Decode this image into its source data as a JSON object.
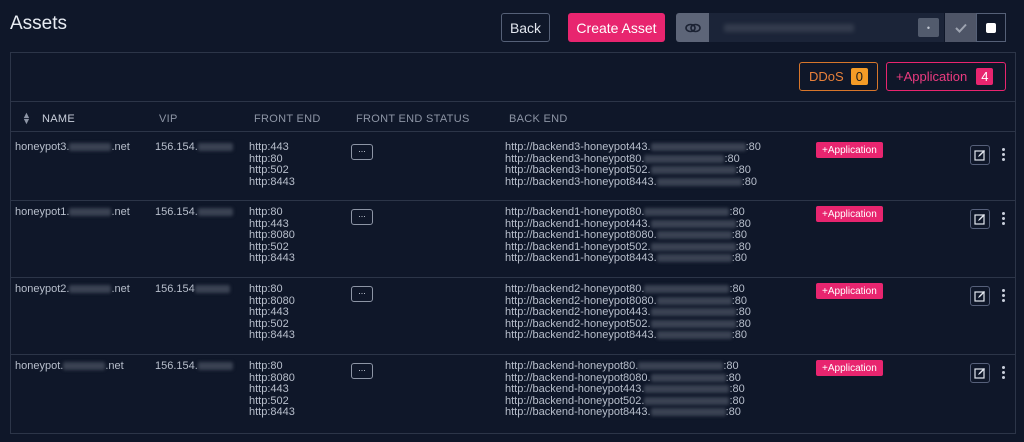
{
  "header": {
    "title": "Assets",
    "back_label": "Back",
    "create_label": "Create Asset",
    "dot_label": "•"
  },
  "badges": {
    "ddos": {
      "label": "DDoS",
      "count": "0"
    },
    "application": {
      "label": "+Application",
      "count": "4"
    }
  },
  "columns": [
    "NAME",
    "VIP",
    "FRONT END",
    "FRONT END STATUS",
    "BACK END"
  ],
  "rows": [
    {
      "name_prefix": "honeypot3.",
      "name_suffix": ".net",
      "vip": "156.154.",
      "front_end": [
        "http:443",
        "http:80",
        "http:502",
        "http:8443"
      ],
      "status": "...",
      "back_end": [
        "http://backend3-honeypot443.",
        "http://backend3-honeypot80.",
        "http://backend3-honeypot502.",
        "http://backend3-honeypot8443."
      ],
      "back_end_port": [
        "80",
        "80",
        "80",
        "80"
      ],
      "tag": "+Application"
    },
    {
      "name_prefix": "honeypot1.",
      "name_suffix": ".net",
      "vip": "156.154.",
      "front_end": [
        "http:80",
        "http:443",
        "http:8080",
        "http:502",
        "http:8443"
      ],
      "status": "...",
      "back_end": [
        "http://backend1-honeypot80.",
        "http://backend1-honeypot443.",
        "http://backend1-honeypot8080.",
        "http://backend1-honeypot502.",
        "http://backend1-honeypot8443."
      ],
      "back_end_port": [
        "80",
        "80",
        "80",
        "80",
        "80"
      ],
      "tag": "+Application"
    },
    {
      "name_prefix": "honeypot2.",
      "name_suffix": ".net",
      "vip": "156.154",
      "front_end": [
        "http:80",
        "http:8080",
        "http:443",
        "http:502",
        "http:8443"
      ],
      "status": "...",
      "back_end": [
        "http://backend2-honeypot80.",
        "http://backend2-honeypot8080.",
        "http://backend2-honeypot443.",
        "http://backend2-honeypot502.",
        "http://backend2-honeypot8443."
      ],
      "back_end_port": [
        "80",
        "80",
        "80",
        "80",
        "80"
      ],
      "tag": "+Application"
    },
    {
      "name_prefix": "honeypot.",
      "name_suffix": ".net",
      "vip": "156.154.",
      "front_end": [
        "http:80",
        "http:8080",
        "http:443",
        "http:502",
        "http:8443"
      ],
      "status": "...",
      "back_end": [
        "http://backend-honeypot80.",
        "http://backend-honeypot8080.",
        "http://backend-honeypot443.",
        "http://backend-honeypot502.",
        "http://backend-honeypot8443."
      ],
      "back_end_port": [
        "80",
        "80",
        "80",
        "80",
        "80"
      ],
      "tag": "+Application"
    }
  ],
  "colors": {
    "background": "#0f1729",
    "accent": "#e8256f",
    "ddos": "#f59b26"
  },
  "icons": [
    "link-icon",
    "check-icon",
    "sort-icon",
    "edit-icon",
    "kebab-icon"
  ]
}
